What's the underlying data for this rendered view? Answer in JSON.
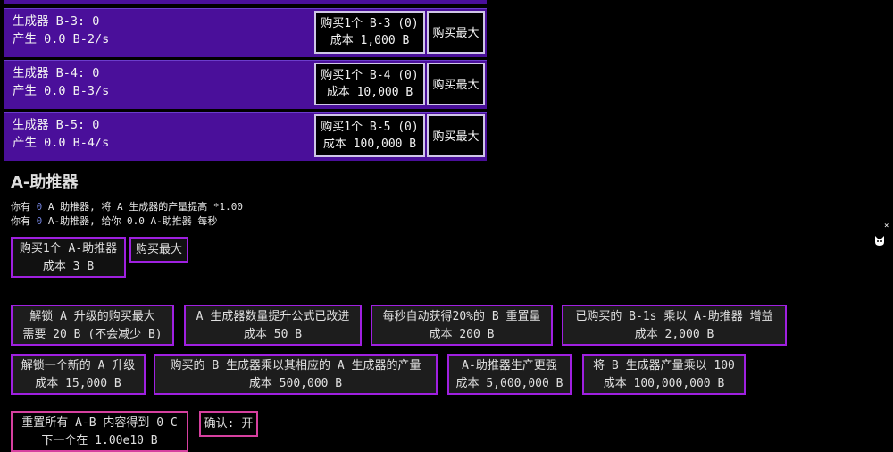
{
  "generators": [
    {
      "label": "生成器 B-3: 0",
      "rate": "产生 0.0 B-2/s",
      "buy_line1": "购买1个 B-3 (0)",
      "buy_line2": "成本 1,000 B",
      "max_label": "购买最大"
    },
    {
      "label": "生成器 B-4: 0",
      "rate": "产生 0.0 B-3/s",
      "buy_line1": "购买1个 B-4 (0)",
      "buy_line2": "成本 10,000 B",
      "max_label": "购买最大"
    },
    {
      "label": "生成器 B-5: 0",
      "rate": "产生 0.0 B-4/s",
      "buy_line1": "购买1个 B-5 (0)",
      "buy_line2": "成本 100,000 B",
      "max_label": "购买最大"
    }
  ],
  "booster": {
    "title": "A-助推器",
    "line1_a": "你有 ",
    "line1_num": "0",
    "line1_b": " A 助推器, 将 A 生成器的产量提高 *1.00",
    "line2_a": "你有 ",
    "line2_num": "0",
    "line2_b": " A-助推器, 给你 0.0 A-助推器 每秒",
    "buy_line1": "购买1个 A-助推器",
    "buy_line2": "成本 3 B",
    "max_label": "购买最大"
  },
  "upgrades": [
    {
      "line1": "解锁 A 升级的购买最大",
      "line2": "需要 20 B (不会减少 B)"
    },
    {
      "line1": "A 生成器数量提升公式已改进",
      "line2": "成本 50 B"
    },
    {
      "line1": "每秒自动获得20%的 B 重置量",
      "line2": "成本 200 B"
    },
    {
      "line1": "已购买的 B-1s 乘以 A-助推器 增益",
      "line2": "成本 2,000 B"
    },
    {
      "line1": "解锁一个新的 A 升级",
      "line2": "成本 15,000 B"
    },
    {
      "line1": "购买的 B 生成器乘以其相应的 A 生成器的产量",
      "line2": "成本 500,000 B"
    },
    {
      "line1": "A-助推器生产更强",
      "line2": "成本 5,000,000 B"
    },
    {
      "line1": "将 B 生成器产量乘以 100",
      "line2": "成本 100,000,000 B"
    }
  ],
  "reset": {
    "line1": "重置所有 A-B 内容得到 0 C",
    "line2": "下一个在 1.00e10 B"
  },
  "confirm": {
    "label": "确认: 开"
  },
  "side": {
    "close": "×"
  }
}
